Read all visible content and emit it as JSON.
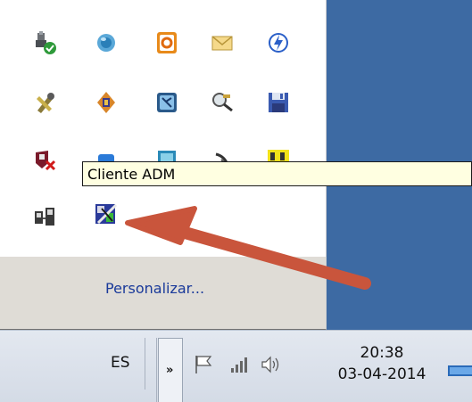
{
  "tray_popup": {
    "customize_link": "Personalizar...",
    "icons": [
      {
        "name": "usb-safely-remove-icon"
      },
      {
        "name": "network-globe-icon"
      },
      {
        "name": "office-icon"
      },
      {
        "name": "mail-envelope-icon"
      },
      {
        "name": "flash-update-icon"
      },
      {
        "name": "tools-wrench-icon"
      },
      {
        "name": "orange-diamond-app-icon"
      },
      {
        "name": "remote-blue-icon"
      },
      {
        "name": "magnifier-key-icon"
      },
      {
        "name": "floppy-save-icon"
      },
      {
        "name": "shield-red-x-icon"
      },
      {
        "name": "blue-app-icon"
      },
      {
        "name": "teal-app-icon"
      },
      {
        "name": "satellite-dish-icon"
      },
      {
        "name": "yellow-network-icon"
      },
      {
        "name": "network-computers-icon"
      },
      {
        "name": "cliente-adm-icon"
      }
    ]
  },
  "tooltip": {
    "text": "Cliente ADM"
  },
  "taskbar": {
    "language": "ES",
    "chevron": "»",
    "clock_time": "20:38",
    "clock_date": "03-04-2014"
  },
  "colors": {
    "desktop": "#3d6aa3",
    "footer": "#dfdcd6",
    "tooltip_bg": "#ffffe1",
    "arrow": "#c9553c",
    "link": "#1a3a9a"
  }
}
